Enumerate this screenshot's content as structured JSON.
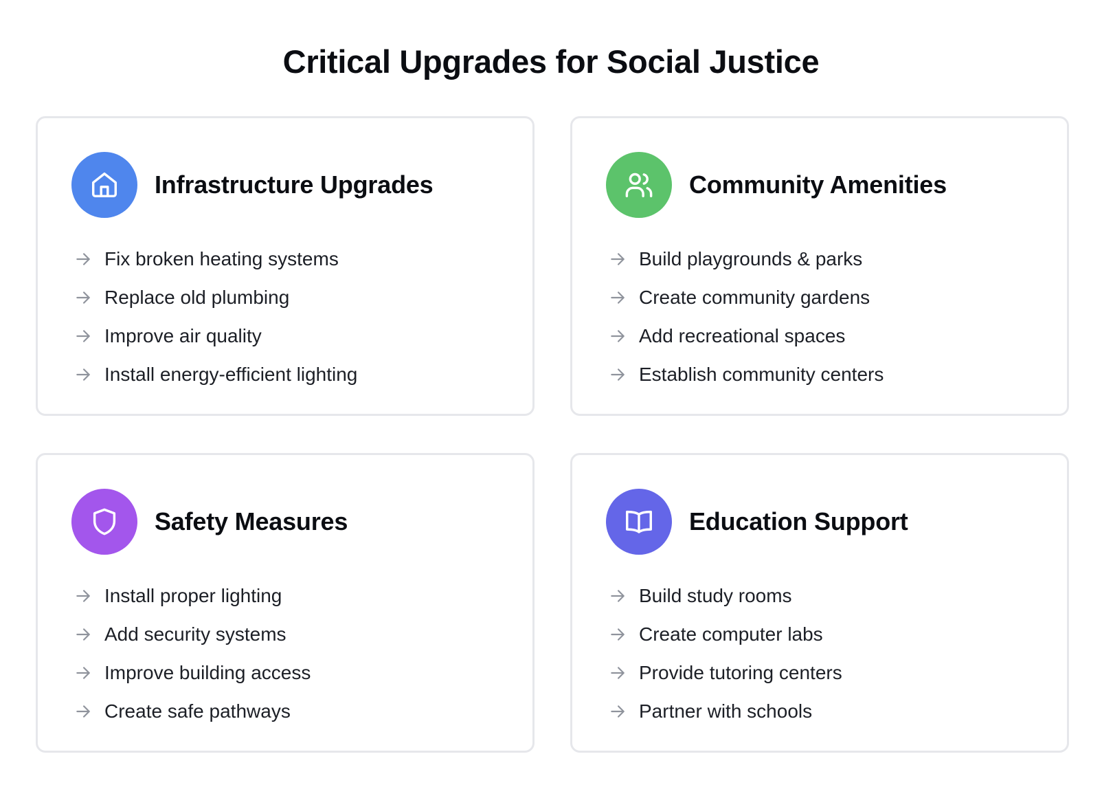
{
  "page": {
    "title": "Critical Upgrades for Social Justice"
  },
  "sections": [
    {
      "title": "Infrastructure Upgrades",
      "icon": "home-icon",
      "icon_color": "#4f86ed",
      "items": [
        "Fix broken heating systems",
        "Replace old plumbing",
        "Improve air quality",
        "Install energy-efficient lighting"
      ]
    },
    {
      "title": "Community Amenities",
      "icon": "users-icon",
      "icon_color": "#5cc36b",
      "items": [
        "Build playgrounds & parks",
        "Create community gardens",
        "Add recreational spaces",
        "Establish community centers"
      ]
    },
    {
      "title": "Safety Measures",
      "icon": "shield-icon",
      "icon_color": "#a356ec",
      "items": [
        "Install proper lighting",
        "Add security systems",
        "Improve building access",
        "Create safe pathways"
      ]
    },
    {
      "title": "Education Support",
      "icon": "book-icon",
      "icon_color": "#6466e8",
      "items": [
        "Build study rooms",
        "Create computer labs",
        "Provide tutoring centers",
        "Partner with schools"
      ]
    }
  ],
  "item_arrow_color": "#8f939c",
  "list_item_icon": "arrow-right-icon"
}
